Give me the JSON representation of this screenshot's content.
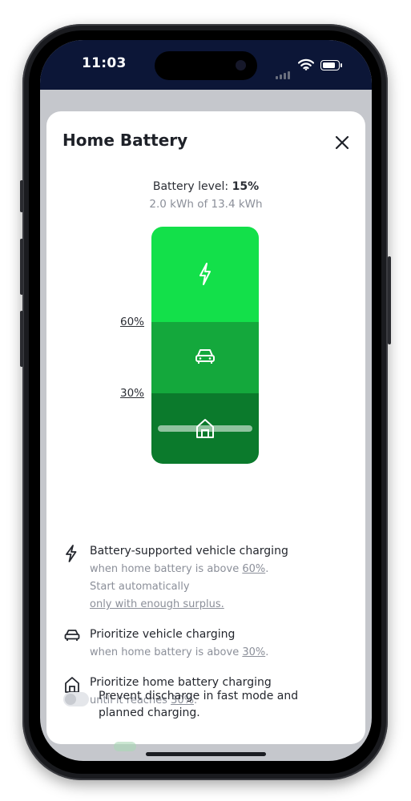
{
  "status_bar": {
    "time": "11:03"
  },
  "sheet": {
    "title": "Home Battery",
    "battery_level_label": "Battery level:",
    "battery_level_value": "15%",
    "battery_energy": "2.0 kWh of 13.4 kWh",
    "battery_level_fraction": 0.15
  },
  "gauge": {
    "threshold_high": "60%",
    "threshold_low": "30%",
    "segment_icons": [
      "bolt-icon",
      "car-icon",
      "home-icon"
    ],
    "colors": {
      "top": "#13e04a",
      "middle": "#14a83c",
      "bottom": "#0b7a2c"
    }
  },
  "legend": {
    "vehicle_support": {
      "title": "Battery-supported vehicle charging",
      "desc_prefix": "when home battery is above ",
      "desc_value": "60%",
      "desc_suffix": ".",
      "line2": "Start automatically",
      "line3": "only with enough surplus."
    },
    "prioritize_vehicle": {
      "title": "Prioritize vehicle charging",
      "desc_prefix": "when home battery is above ",
      "desc_value": "30%",
      "desc_suffix": "."
    },
    "prioritize_home": {
      "title": "Prioritize home battery charging",
      "desc_prefix": "until it reaches ",
      "desc_value": "30%",
      "desc_suffix": "."
    }
  },
  "prevent_discharge": {
    "label": "Prevent discharge in fast mode and planned charging.",
    "enabled": false
  }
}
